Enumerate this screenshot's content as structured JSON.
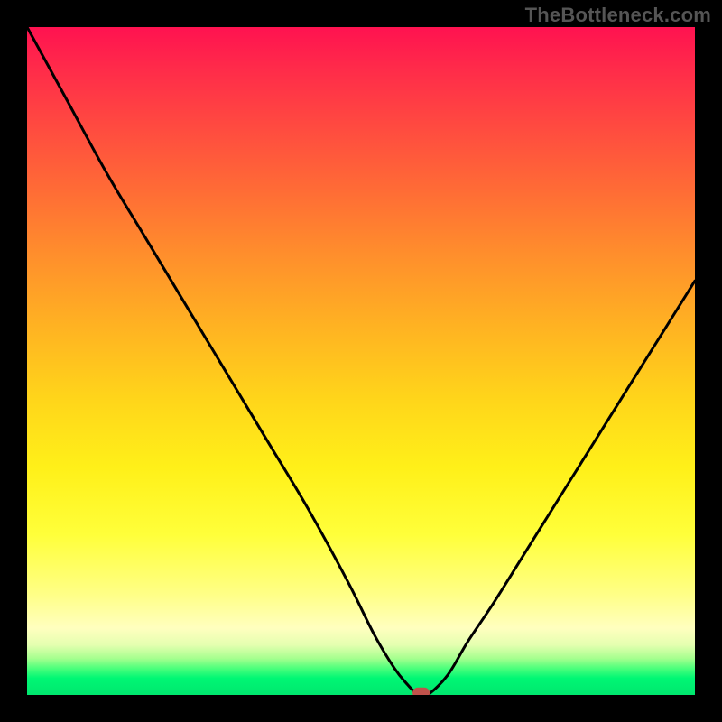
{
  "watermark": "TheBottleneck.com",
  "colors": {
    "background": "#000000",
    "curve": "#000000",
    "marker": "#c0524b",
    "gradient_top": "#ff1250",
    "gradient_bottom": "#00e66e"
  },
  "chart_data": {
    "type": "line",
    "title": "",
    "xlabel": "",
    "ylabel": "",
    "xlim": [
      0,
      100
    ],
    "ylim": [
      0,
      100
    ],
    "x": [
      0,
      6,
      12,
      18,
      24,
      30,
      36,
      42,
      48,
      52,
      55,
      57,
      58,
      59,
      60,
      63,
      66,
      70,
      75,
      80,
      85,
      90,
      95,
      100
    ],
    "values": [
      100,
      89,
      78,
      68,
      58,
      48,
      38,
      28,
      17,
      9,
      4,
      1.5,
      0.5,
      0,
      0,
      3,
      8,
      14,
      22,
      30,
      38,
      46,
      54,
      62
    ],
    "marker": {
      "x": 59,
      "y": 0.3,
      "shape": "pill",
      "color": "#c0524b"
    },
    "notes": "V-shaped bottleneck curve; minimum (optimal point) at roughly x≈59. Background is a vertical heat gradient from red (high bottleneck) at top to green (no bottleneck) at bottom. No axis ticks or labels are visible."
  }
}
